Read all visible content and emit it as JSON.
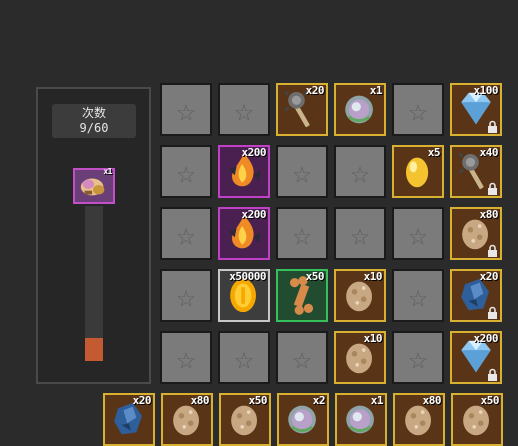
{
  "panel": {
    "title": "次数",
    "count": "9/60",
    "reward_qty": "x1",
    "progress_fraction": 0.15
  },
  "grid": [
    [
      {
        "type": "empty"
      },
      {
        "type": "empty"
      },
      {
        "type": "item",
        "frame": "gold",
        "icon": "mace-icon",
        "qty": "x20"
      },
      {
        "type": "item",
        "frame": "gold",
        "icon": "crystal-orb-icon",
        "qty": "x1"
      },
      {
        "type": "empty"
      },
      {
        "type": "item",
        "frame": "gold",
        "icon": "diamond-icon",
        "qty": "x100",
        "locked": true
      }
    ],
    [
      {
        "type": "empty"
      },
      {
        "type": "item",
        "frame": "purple",
        "icon": "fire-crystal-icon",
        "qty": "x200"
      },
      {
        "type": "empty"
      },
      {
        "type": "empty"
      },
      {
        "type": "item",
        "frame": "gold",
        "icon": "golden-egg-icon",
        "qty": "x5"
      },
      {
        "type": "item",
        "frame": "gold",
        "icon": "mace-icon",
        "qty": "x40",
        "locked": true
      }
    ],
    [
      {
        "type": "empty"
      },
      {
        "type": "item",
        "frame": "purple",
        "icon": "fire-crystal-icon",
        "qty": "x200"
      },
      {
        "type": "empty"
      },
      {
        "type": "empty"
      },
      {
        "type": "empty"
      },
      {
        "type": "item",
        "frame": "gold",
        "icon": "stone-egg-icon",
        "qty": "x80",
        "locked": true
      }
    ],
    [
      {
        "type": "empty"
      },
      {
        "type": "item",
        "frame": "silver",
        "icon": "gold-coin-icon",
        "qty": "x50000"
      },
      {
        "type": "item",
        "frame": "green",
        "icon": "bone-icon",
        "qty": "x50"
      },
      {
        "type": "item",
        "frame": "gold",
        "icon": "stone-egg-icon",
        "qty": "x10"
      },
      {
        "type": "empty"
      },
      {
        "type": "item",
        "frame": "gold",
        "icon": "blue-ore-icon",
        "qty": "x20",
        "locked": true
      }
    ],
    [
      {
        "type": "empty"
      },
      {
        "type": "empty"
      },
      {
        "type": "empty"
      },
      {
        "type": "item",
        "frame": "gold",
        "icon": "stone-egg-icon",
        "qty": "x10"
      },
      {
        "type": "empty"
      },
      {
        "type": "item",
        "frame": "gold",
        "icon": "diamond-icon",
        "qty": "x200",
        "locked": true
      }
    ]
  ],
  "bottom_row": [
    {
      "type": "item",
      "frame": "gold",
      "icon": "blue-ore-icon",
      "qty": "x20"
    },
    {
      "type": "item",
      "frame": "gold",
      "icon": "stone-egg-icon",
      "qty": "x80"
    },
    {
      "type": "item",
      "frame": "gold",
      "icon": "stone-egg-icon",
      "qty": "x50"
    },
    {
      "type": "item",
      "frame": "gold",
      "icon": "crystal-orb-icon",
      "qty": "x2"
    },
    {
      "type": "item",
      "frame": "gold",
      "icon": "crystal-orb-icon",
      "qty": "x1"
    },
    {
      "type": "item",
      "frame": "gold",
      "icon": "stone-egg-icon",
      "qty": "x80"
    },
    {
      "type": "item",
      "frame": "gold",
      "icon": "stone-egg-icon",
      "qty": "x50"
    }
  ]
}
